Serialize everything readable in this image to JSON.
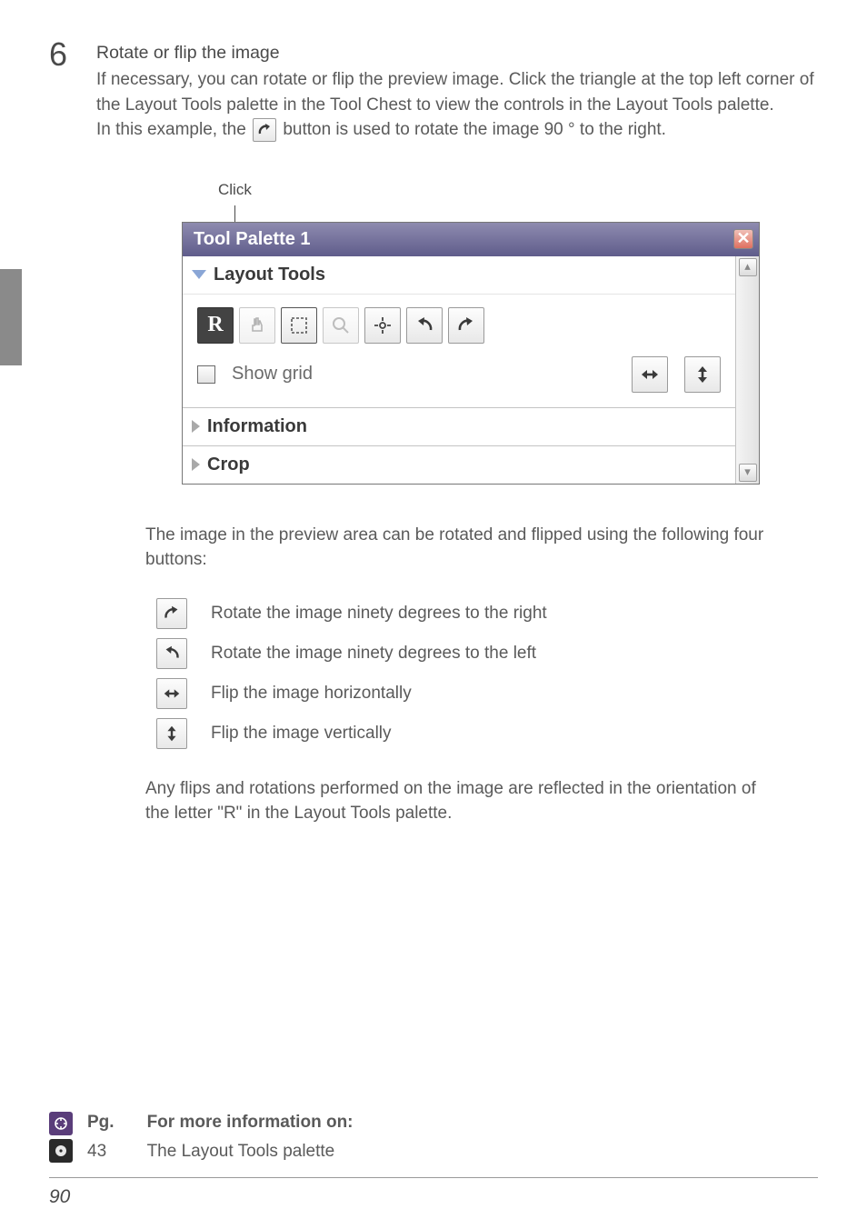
{
  "step": {
    "number": "6",
    "title": "Rotate or flip the image",
    "para1": "If necessary, you can rotate or flip the preview image.  Click the triangle at the top left corner of the Layout Tools palette in the Tool Chest to view the controls in the Layout Tools palette.",
    "para2a": "In this example, the ",
    "para2b": " button is used to rotate the image 90 ° to the right."
  },
  "click_label": "Click",
  "palette": {
    "title": "Tool Palette 1",
    "layout_head": "Layout Tools",
    "show_grid": "Show grid",
    "info_head": "Information",
    "crop_head": "Crop"
  },
  "summary": "The image in the preview area can be rotated and flipped using the following four buttons:",
  "icons": {
    "rot_right": "Rotate the image ninety degrees to the right",
    "rot_left": "Rotate the image ninety degrees to the left",
    "flip_h": "Flip the image horizontally",
    "flip_v": "Flip the image vertically"
  },
  "final": "Any flips and rotations performed on the image are reflected in the orientation of the letter \"R\" in the Layout Tools palette.",
  "refs": {
    "pg_head": "Pg.",
    "info_head": "For more information on:",
    "pg": "43",
    "text": "The Layout Tools palette"
  },
  "page_number": "90"
}
